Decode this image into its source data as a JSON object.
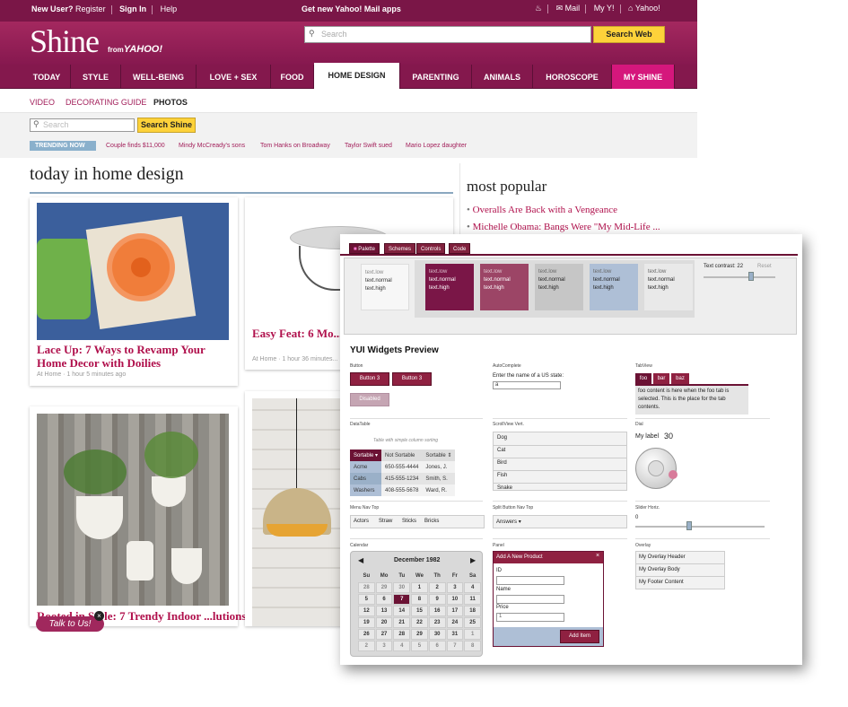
{
  "topbar": {
    "new_user": "New User?",
    "register": "Register",
    "sign_in": "Sign In",
    "help": "Help",
    "promo": "Get new Yahoo! Mail apps",
    "mail": "Mail",
    "my_y": "My Y!",
    "yahoo": "Yahoo!"
  },
  "header": {
    "logo": "Shine",
    "logo_from": "from",
    "logo_yahoo": "YAHOO!",
    "search_placeholder": "Search",
    "search_button": "Search Web"
  },
  "nav": {
    "items": [
      "TODAY",
      "STYLE",
      "WELL-BEING",
      "LOVE + SEX",
      "FOOD",
      "HOME DESIGN",
      "PARENTING",
      "ANIMALS",
      "HOROSCOPE",
      "MY SHINE"
    ],
    "active": "HOME DESIGN"
  },
  "subnav": {
    "items": [
      "VIDEO",
      "DECORATING GUIDE",
      "PHOTOS"
    ]
  },
  "search2": {
    "placeholder": "Search",
    "button": "Search Shine"
  },
  "trending": {
    "label": "TRENDING NOW",
    "links": [
      "Couple finds $11,000",
      "Mindy McCready's sons",
      "Tom Hanks on Broadway",
      "Taylor Swift sued",
      "Mario Lopez daughter"
    ]
  },
  "main": {
    "title": "today in home design"
  },
  "cards": [
    {
      "title": "Lace Up: 7 Ways to Revamp Your Home Decor with Doilies",
      "meta": "At Home  ·  1 hour 5 minutes ago"
    },
    {
      "title": "Easy Feat: 6 Mo... to Update Your ...",
      "meta": "At Home  ·  1 hour 36 minutes..."
    },
    {
      "title": "Rooted in Style: 7 Trendy Indoor ...lutions",
      "meta": ""
    }
  ],
  "talk": "Talk to Us!",
  "most_popular": {
    "title": "most popular",
    "items": [
      "Overalls Are Back with a Vengeance",
      "Michelle Obama: Bangs Were \"My Mid-Life ..."
    ]
  },
  "yui": {
    "tabs": [
      "Palette",
      "Schemes",
      "Controls",
      "Code"
    ],
    "swatches": [
      {
        "l": "text.low",
        "n": "text.normal",
        "h": "text.high"
      },
      {
        "l": "text.low",
        "n": "text.normal",
        "h": "text.high"
      },
      {
        "l": "text.low",
        "n": "text.normal",
        "h": "text.high"
      },
      {
        "l": "text.low",
        "n": "text.normal",
        "h": "text.high"
      },
      {
        "l": "text.low",
        "n": "text.normal",
        "h": "text.high"
      },
      {
        "l": "text.low",
        "n": "text.normal",
        "h": "text.high"
      }
    ],
    "contrast_label": "Text contrast:",
    "contrast_value": "22",
    "reset": "Reset",
    "heading": "YUI Widgets Preview",
    "button": {
      "label": "Button",
      "b1": "Button 3",
      "b2": "Button 3",
      "disabled": "Disabled"
    },
    "autocomplete": {
      "label": "AutoComplete",
      "prompt": "Enter the name of a US state:",
      "value": "a"
    },
    "tabview": {
      "label": "TabView",
      "tabs": [
        "foo",
        "bar",
        "baz"
      ],
      "content": "foo content is here when the foo tab is selected. This is the place for the tab contents."
    },
    "datatable": {
      "label": "DataTable",
      "caption": "Table with simple column sorting",
      "headers": [
        "Sortable",
        "Not Sortable",
        "Sortable"
      ],
      "rows": [
        [
          "Acme",
          "650-555-4444",
          "Jones, J."
        ],
        [
          "Cabs",
          "415-555-1234",
          "Smith, S."
        ],
        [
          "Washers",
          "408-555-5678",
          "Ward, R."
        ]
      ]
    },
    "scrollview": {
      "label": "ScrollView Vert.",
      "items": [
        "Dog",
        "Cat",
        "Bird",
        "Fish",
        "Snake"
      ]
    },
    "dial": {
      "label": "Dial",
      "my_label": "My label",
      "value": "30"
    },
    "menu": {
      "label": "Menu Nav Top",
      "items": [
        "Actors",
        "Straw",
        "Sticks",
        "Bricks"
      ]
    },
    "split": {
      "label": "Split Button Nav Top",
      "button": "Answers"
    },
    "slider": {
      "label": "Slider Horiz.",
      "value": "0",
      "level": 0.42
    },
    "calendar": {
      "label": "Calendar",
      "month": "December 1982",
      "days": [
        "Su",
        "Mo",
        "Tu",
        "We",
        "Th",
        "Fr",
        "Sa"
      ],
      "weeks": [
        [
          "28",
          "29",
          "30",
          "1",
          "2",
          "3",
          "4"
        ],
        [
          "5",
          "6",
          "7",
          "8",
          "9",
          "10",
          "11"
        ],
        [
          "12",
          "13",
          "14",
          "15",
          "16",
          "17",
          "18"
        ],
        [
          "19",
          "20",
          "21",
          "22",
          "23",
          "24",
          "25"
        ],
        [
          "26",
          "27",
          "28",
          "29",
          "30",
          "31",
          "1"
        ],
        [
          "2",
          "3",
          "4",
          "5",
          "6",
          "7",
          "8"
        ]
      ],
      "selected": "7"
    },
    "panel": {
      "label": "Panel",
      "header": "Add A New Product",
      "id": "ID",
      "name": "Name",
      "price": "Price",
      "price_value": "1",
      "button": "Add Item"
    },
    "overlay": {
      "label": "Overlay",
      "header": "My Overlay Header",
      "body": "My Overlay Body",
      "footer": "My Footer Content"
    }
  },
  "colors": {
    "brand": "#84184d",
    "accent": "#b0104c",
    "yellow": "#fdd23a",
    "trend": "#8ab0cc"
  }
}
